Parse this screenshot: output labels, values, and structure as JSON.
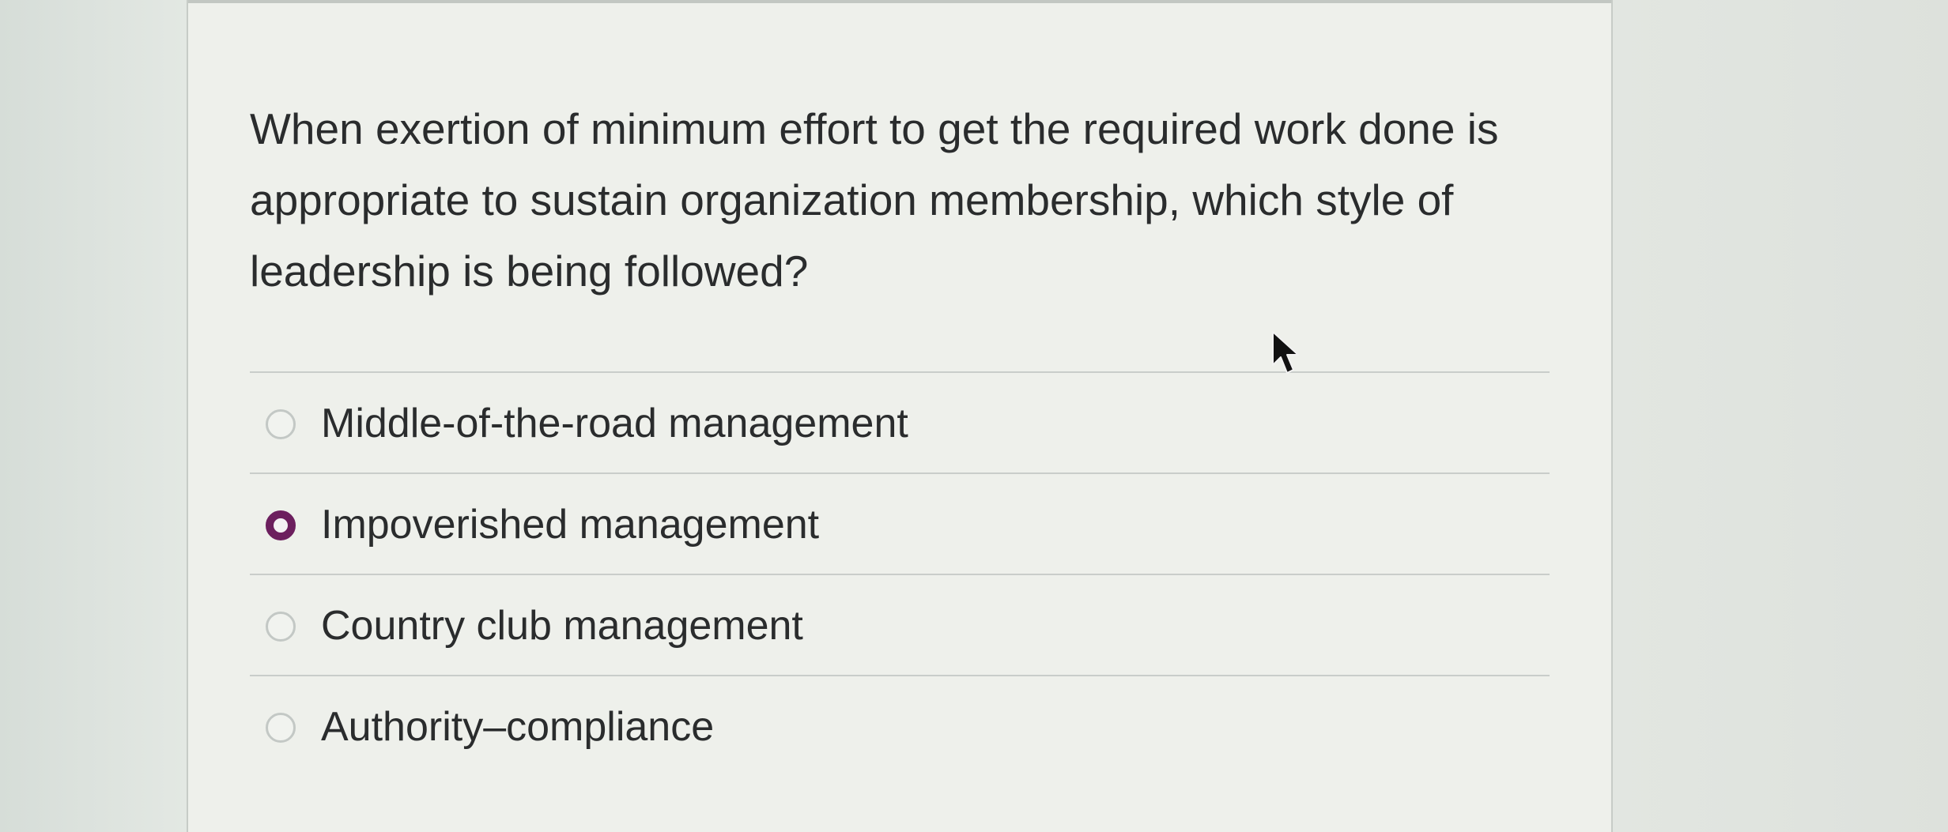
{
  "question": {
    "text": "When exertion of minimum effort to get the required work done is appropriate to sustain organization membership, which style of leadership is being followed?"
  },
  "options": [
    {
      "label": "Middle-of-the-road management",
      "selected": false
    },
    {
      "label": "Impoverished management",
      "selected": true
    },
    {
      "label": "Country club management",
      "selected": false
    },
    {
      "label": "Authority–compliance",
      "selected": false
    }
  ],
  "colors": {
    "selected_radio": "#6c1f5e",
    "text": "#2a2c2d",
    "divider": "#c9cdca"
  },
  "icons": {
    "cursor": "mouse-pointer-icon",
    "radio": "radio-button-icon"
  }
}
